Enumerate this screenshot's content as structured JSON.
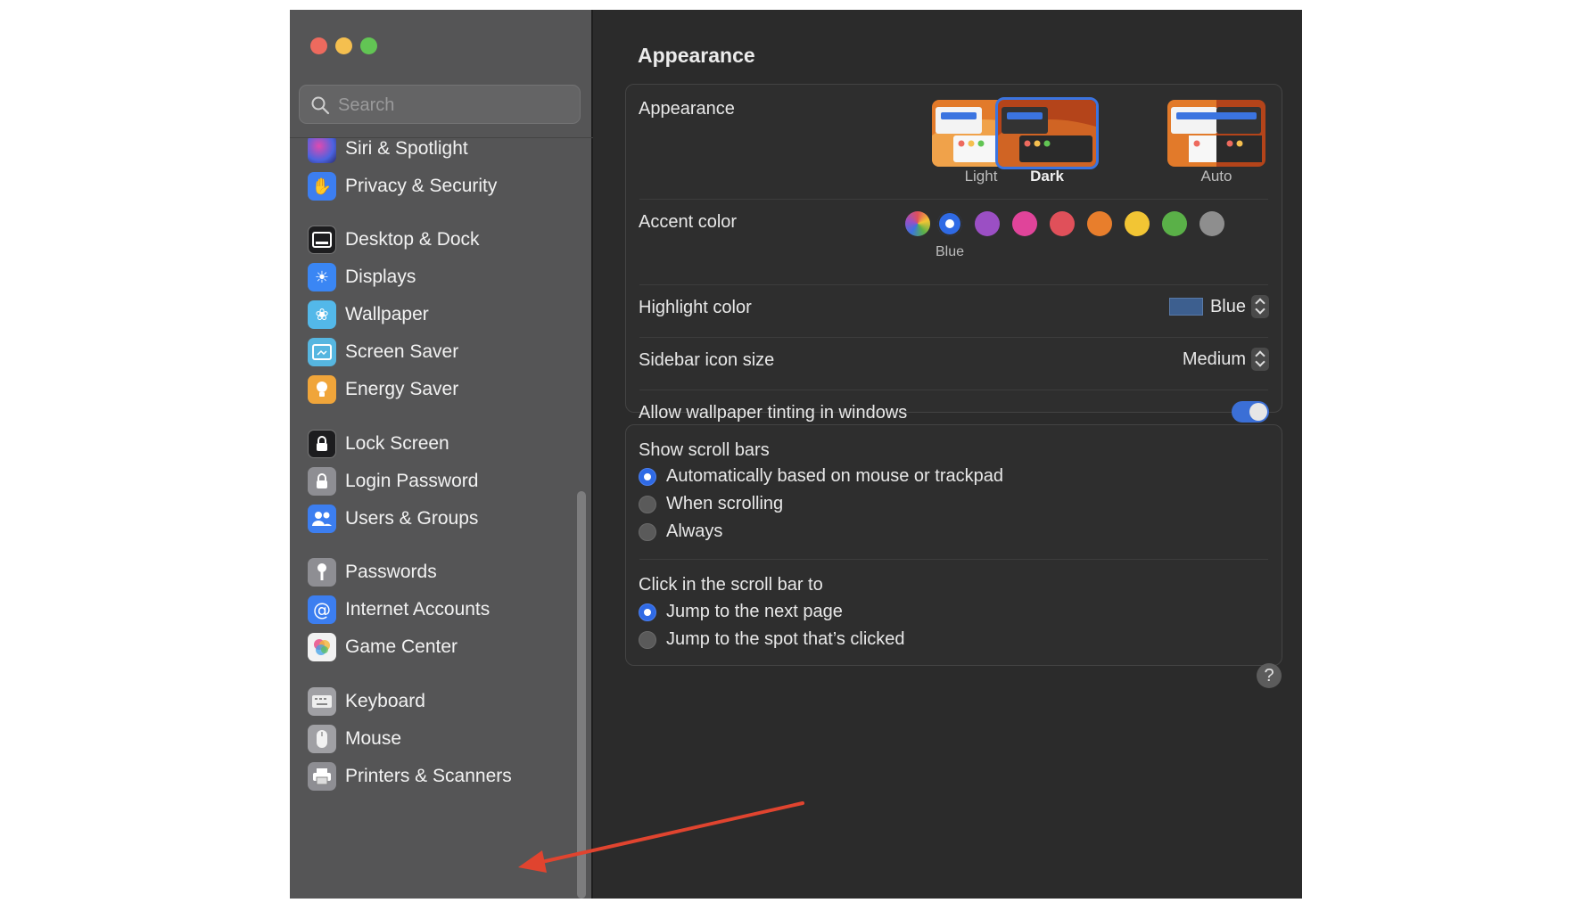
{
  "window": {
    "traffic_lights": [
      {
        "name": "close",
        "color": "#ed6a5e"
      },
      {
        "name": "minimize",
        "color": "#f5bf4f"
      },
      {
        "name": "zoom",
        "color": "#62c554"
      }
    ]
  },
  "search": {
    "placeholder": "Search",
    "icon": "magnifier-icon"
  },
  "sidebar": {
    "items": [
      {
        "label": "Siri & Spotlight",
        "icon": "siri-icon",
        "color": "#7b4fd1"
      },
      {
        "label": "Privacy & Security",
        "icon": "hand-icon",
        "color": "#3c7ef0"
      },
      {
        "label": "Desktop & Dock",
        "icon": "dock-icon",
        "color": "#1d1d1f"
      },
      {
        "label": "Displays",
        "icon": "sun-icon",
        "color": "#3a86f4"
      },
      {
        "label": "Wallpaper",
        "icon": "flower-icon",
        "color": "#53b8e9"
      },
      {
        "label": "Screen Saver",
        "icon": "screen-saver-icon",
        "color": "#56b6e0"
      },
      {
        "label": "Energy Saver",
        "icon": "lightbulb-icon",
        "color": "#f0a53a"
      },
      {
        "label": "Lock Screen",
        "icon": "lock-icon",
        "color": "#1d1d1f"
      },
      {
        "label": "Login Password",
        "icon": "lock-icon",
        "color": "#8e8e93"
      },
      {
        "label": "Users & Groups",
        "icon": "users-icon",
        "color": "#3c7ef0"
      },
      {
        "label": "Passwords",
        "icon": "key-icon",
        "color": "#8e8e93"
      },
      {
        "label": "Internet Accounts",
        "icon": "at-icon",
        "color": "#3c7ef0"
      },
      {
        "label": "Game Center",
        "icon": "game-center-icon",
        "color": "#f2f2f2"
      },
      {
        "label": "Keyboard",
        "icon": "keyboard-icon",
        "color": "#a0a0a4"
      },
      {
        "label": "Mouse",
        "icon": "mouse-icon",
        "color": "#a0a0a4"
      },
      {
        "label": "Printers & Scanners",
        "icon": "printer-icon",
        "color": "#8e8e93"
      }
    ]
  },
  "main": {
    "title": "Appearance",
    "appearance": {
      "label": "Appearance",
      "options": [
        {
          "label": "Light",
          "selected": false
        },
        {
          "label": "Dark",
          "selected": true
        },
        {
          "label": "Auto",
          "selected": false
        }
      ]
    },
    "accent": {
      "label": "Accent color",
      "selected_name": "Blue",
      "colors": [
        "multicolor",
        "#2f6ae5",
        "#9b4fc4",
        "#e0449a",
        "#e0505a",
        "#e87e2c",
        "#f2c534",
        "#5ab048",
        "#8e8e8e"
      ]
    },
    "highlight": {
      "label": "Highlight color",
      "value": "Blue",
      "swatch": "#3d5f8f"
    },
    "icon_size": {
      "label": "Sidebar icon size",
      "value": "Medium"
    },
    "tinting": {
      "label": "Allow wallpaper tinting in windows",
      "on": true
    },
    "scroll_bars": {
      "label": "Show scroll bars",
      "options": [
        {
          "label": "Automatically based on mouse or trackpad",
          "selected": true
        },
        {
          "label": "When scrolling",
          "selected": false
        },
        {
          "label": "Always",
          "selected": false
        }
      ]
    },
    "click_scroll": {
      "label": "Click in the scroll bar to",
      "options": [
        {
          "label": "Jump to the next page",
          "selected": true
        },
        {
          "label": "Jump to the spot that’s clicked",
          "selected": false
        }
      ]
    },
    "help": "?"
  },
  "annotation": {
    "arrow_color": "#e0442f",
    "points_to": "Printers & Scanners"
  }
}
